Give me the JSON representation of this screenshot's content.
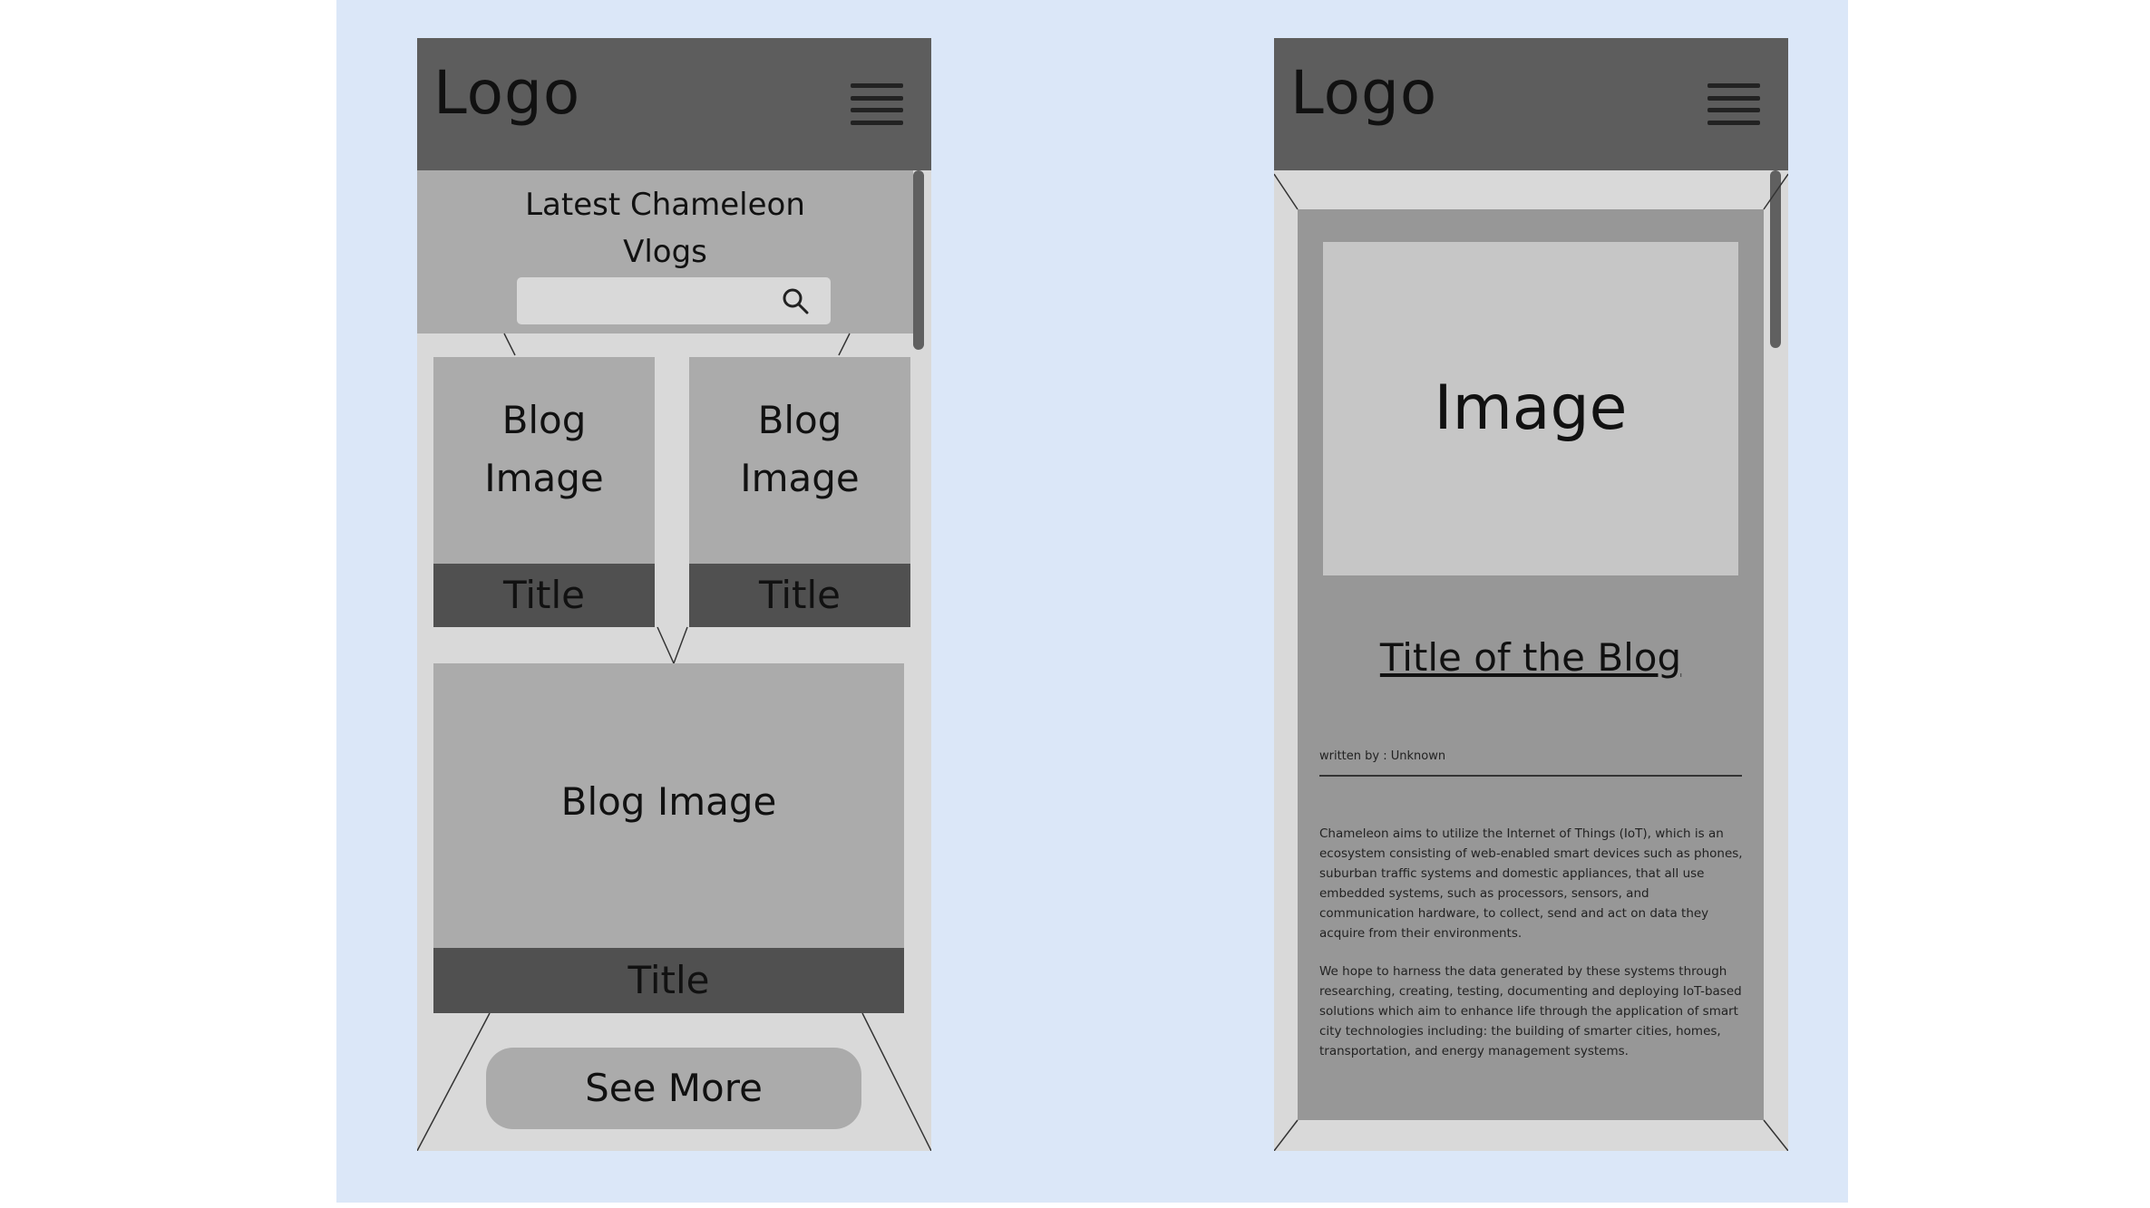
{
  "left_screen": {
    "logo": "Logo",
    "hero_title": "Latest Chameleon\nVlogs",
    "search": {
      "value": ""
    },
    "cards": [
      {
        "image_label": "Blog\nImage",
        "title": "Title"
      },
      {
        "image_label": "Blog\nImage",
        "title": "Title"
      }
    ],
    "featured": {
      "image_label": "Blog Image",
      "title": "Title"
    },
    "see_more_label": "See More"
  },
  "right_screen": {
    "logo": "Logo",
    "image_label": "Image",
    "blog_title": "Title of the Blog",
    "author": "written by : Unknown",
    "paragraphs": [
      "Chameleon aims to utilize the Internet of Things (IoT), which is an ecosystem consisting of web-enabled smart devices such as phones, suburban traffic systems and domestic appliances, that all use embedded systems, such as processors, sensors, and communication hardware, to collect, send and act on data they acquire from their environments.",
      "We hope to harness the data generated by these systems through researching, creating, testing, documenting and deploying IoT-based solutions which aim to enhance life through the application of smart city technologies including: the building of smarter cities, homes, transportation, and energy management systems."
    ]
  },
  "icons": {
    "search": "search-icon",
    "menu": "hamburger-menu-icon"
  },
  "colors": {
    "canvas": "#dbe7f8",
    "header": "#5d5d5d",
    "panel": "#ababab",
    "title_bar": "#505050",
    "phone_bg": "#d9d9d9"
  }
}
